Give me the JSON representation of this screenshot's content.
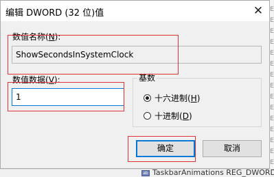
{
  "background": {
    "right_rows": [
      "RE",
      "RE",
      "RE",
      "RE",
      "RE",
      "RE",
      "RE",
      "RE",
      "RE",
      "RE",
      "RE",
      "RE",
      "RE",
      "RE",
      "RE"
    ],
    "bottom_row": "TaskbarAnimations   REG_DWORD"
  },
  "dialog": {
    "title": "编辑 DWORD (32 位)值",
    "close_glyph": "✕",
    "name_label_prefix": "数值名称(",
    "name_label_key": "N",
    "name_label_suffix": "):",
    "name_value": "ShowSecondsInSystemClock",
    "data_label_prefix": "数值数据(",
    "data_label_key": "V",
    "data_label_suffix": "):",
    "data_value": "1",
    "base_group_label": "基数",
    "radio_hex_prefix": "十六进制(",
    "radio_hex_key": "H",
    "radio_hex_suffix": ")",
    "radio_dec_prefix": "十进制(",
    "radio_dec_key": "D",
    "radio_dec_suffix": ")",
    "selected_base": "hex",
    "ok_label": "确定",
    "cancel_label": "取消"
  },
  "colors": {
    "highlight_box": "#e0303a",
    "focus_accent": "#0078d7"
  }
}
